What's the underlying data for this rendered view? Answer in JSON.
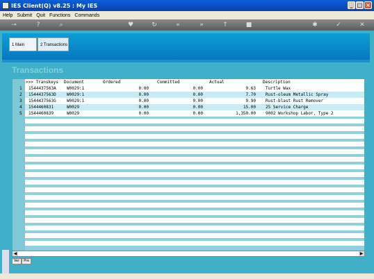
{
  "window": {
    "title": "IES Client(Q) v8.25 : My IES"
  },
  "menu": [
    "Help",
    "Submit",
    "Quit",
    "Functions",
    "Commands"
  ],
  "tabs": [
    {
      "label": "1 Main"
    },
    {
      "label": "2 Transactions"
    }
  ],
  "page": {
    "title": "Transactions"
  },
  "grid": {
    "columns": [
      ">>> Transkeys",
      "Document",
      "Ordered",
      "Committed",
      "Actual",
      "Description"
    ],
    "rows": [
      {
        "n": "1",
        "key": "1544437563A",
        "doc": "W0029:1",
        "ordered": "0.00",
        "committed": "0.00",
        "actual": "9.63",
        "desc": "Turtle Wax"
      },
      {
        "n": "2",
        "key": "1544437563D",
        "doc": "W0029:1",
        "ordered": "0.00",
        "committed": "0.00",
        "actual": "7.70",
        "desc": "Rust-oleum Metallic Spray"
      },
      {
        "n": "3",
        "key": "1544437563G",
        "doc": "W0029:1",
        "ordered": "0.00",
        "committed": "0.00",
        "actual": "9.90",
        "desc": "Rust-blast Rust Remover"
      },
      {
        "n": "4",
        "key": "1544460831",
        "doc": "W0029",
        "ordered": "0.00",
        "committed": "0.00",
        "actual": "15.00",
        "desc": "25 Service Charge"
      },
      {
        "n": "5",
        "key": "1544460839",
        "doc": "W0029",
        "ordered": "0.00",
        "committed": "0.00",
        "actual": "1,350.00",
        "desc": "9002 Workshop Labor, Type 2"
      }
    ]
  },
  "bottom_tabs": [
    "Ver",
    "Pre"
  ]
}
